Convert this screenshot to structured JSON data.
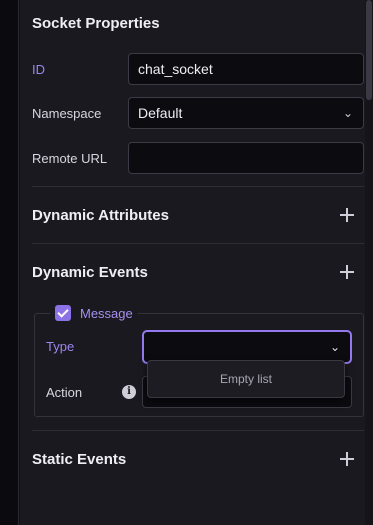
{
  "panel": {
    "title": "Socket Properties",
    "fields": {
      "id": {
        "label": "ID",
        "value": "chat_socket"
      },
      "namespace": {
        "label": "Namespace",
        "value": "Default"
      },
      "remote_url": {
        "label": "Remote URL",
        "value": ""
      }
    }
  },
  "sections": {
    "dynamic_attributes": "Dynamic Attributes",
    "dynamic_events": "Dynamic Events",
    "static_events": "Static Events"
  },
  "event": {
    "label": "Message",
    "checked": true,
    "type_label": "Type",
    "type_value": "",
    "action_label": "Action",
    "action_value": "",
    "dropdown_empty": "Empty list"
  },
  "icons": {
    "namespace_select": "chevron-down-icon",
    "type_select": "chevron-down-icon",
    "add": "plus-icon",
    "info": "info-icon",
    "checkbox": "checkmark-icon"
  },
  "colors": {
    "accent": "#9479ee",
    "panel_bg": "#1a191f",
    "input_bg": "#0c0b10"
  }
}
